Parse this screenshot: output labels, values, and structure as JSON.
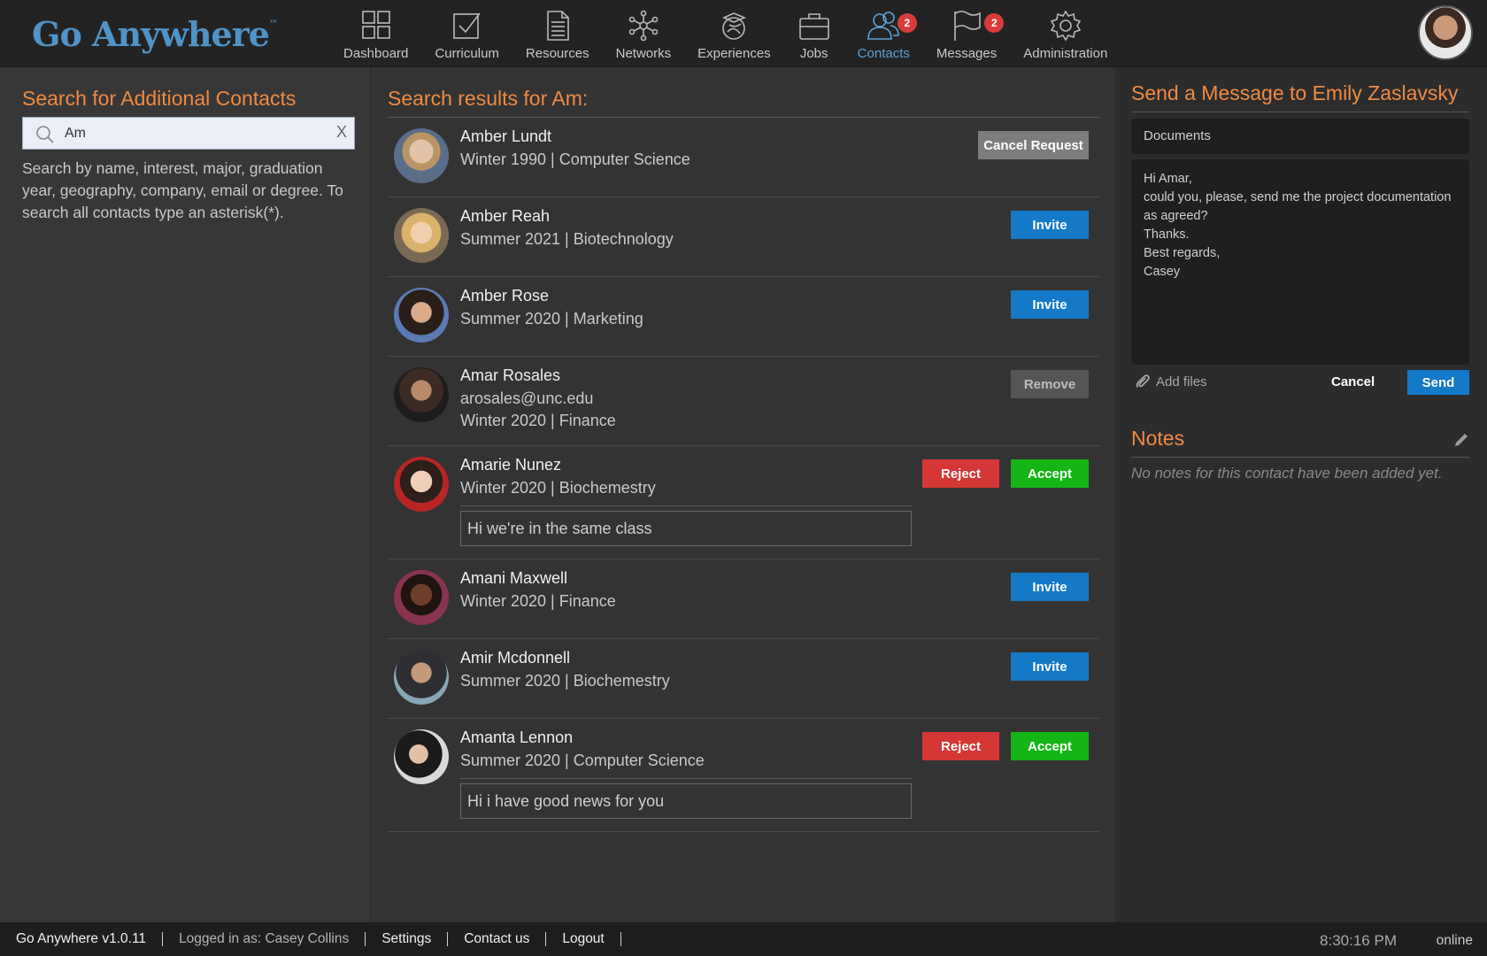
{
  "app": {
    "logo_text": "Go Anywhere",
    "logo_tm": "™"
  },
  "nav": {
    "items": [
      {
        "label": "Dashboard",
        "icon": "dashboard-icon"
      },
      {
        "label": "Curriculum",
        "icon": "checkbox-icon"
      },
      {
        "label": "Resources",
        "icon": "document-icon"
      },
      {
        "label": "Networks",
        "icon": "network-icon"
      },
      {
        "label": "Experiences",
        "icon": "graduation-globe-icon"
      },
      {
        "label": "Jobs",
        "icon": "briefcase-icon"
      },
      {
        "label": "Contacts",
        "icon": "contacts-icon",
        "badge": "2",
        "active": true
      },
      {
        "label": "Messages",
        "icon": "flag-icon",
        "badge": "2"
      },
      {
        "label": "Administration",
        "icon": "gear-icon"
      }
    ]
  },
  "left": {
    "title": "Search for Additional Contacts",
    "search_value": "Am",
    "clear_label": "X",
    "help_text": "Search by name, interest, major, graduation year, geography, company, email or degree. To search all contacts type an asterisk(*)."
  },
  "middle": {
    "title": "Search results for Am:",
    "results": [
      {
        "name": "Amber Lundt",
        "line1": "Winter 1990 | Computer Science",
        "actions": [
          "Cancel Request"
        ]
      },
      {
        "name": "Amber Reah",
        "line1": "Summer 2021 | Biotechnology",
        "actions": [
          "Invite"
        ]
      },
      {
        "name": "Amber Rose",
        "line1": "Summer 2020 | Marketing",
        "actions": [
          "Invite"
        ]
      },
      {
        "name": "Amar Rosales",
        "line1": "arosales@unc.edu",
        "line2": "Winter 2020 | Finance",
        "actions": [
          "Remove"
        ]
      },
      {
        "name": "Amarie Nunez",
        "line1": "Winter 2020 | Biochemestry",
        "note": "Hi we're in the same class",
        "actions": [
          "Reject",
          "Accept"
        ]
      },
      {
        "name": "Amani Maxwell",
        "line1": "Winter 2020 | Finance",
        "actions": [
          "Invite"
        ]
      },
      {
        "name": "Amir Mcdonnell",
        "line1": "Summer 2020 | Biochemestry",
        "actions": [
          "Invite"
        ]
      },
      {
        "name": "Amanta Lennon",
        "line1": "Summer 2020 | Computer Science",
        "note": "Hi i have good news for you",
        "actions": [
          "Reject",
          "Accept"
        ]
      }
    ]
  },
  "right": {
    "title": "Send a Message to Emily Zaslavsky",
    "subject": "Documents",
    "body": "Hi Amar,\ncould you, please, send me the project documentation as agreed?\nThanks.\nBest regards,\nCasey",
    "add_files": "Add files",
    "cancel": "Cancel",
    "send": "Send",
    "notes_title": "Notes",
    "notes_empty": "No notes for this contact have been added yet."
  },
  "footer": {
    "version": "Go Anywhere v1.0.11",
    "logged_in": "Logged in as: Casey Collins",
    "settings": "Settings",
    "contact_us": "Contact us",
    "logout": "Logout",
    "time": "8:30:16 PM",
    "status": "online"
  },
  "colors": {
    "accent_orange": "#ef8a42",
    "primary_blue": "#1479c7",
    "reject_red": "#d53737",
    "accept_green": "#16b516",
    "badge_red": "#d83b3b"
  }
}
